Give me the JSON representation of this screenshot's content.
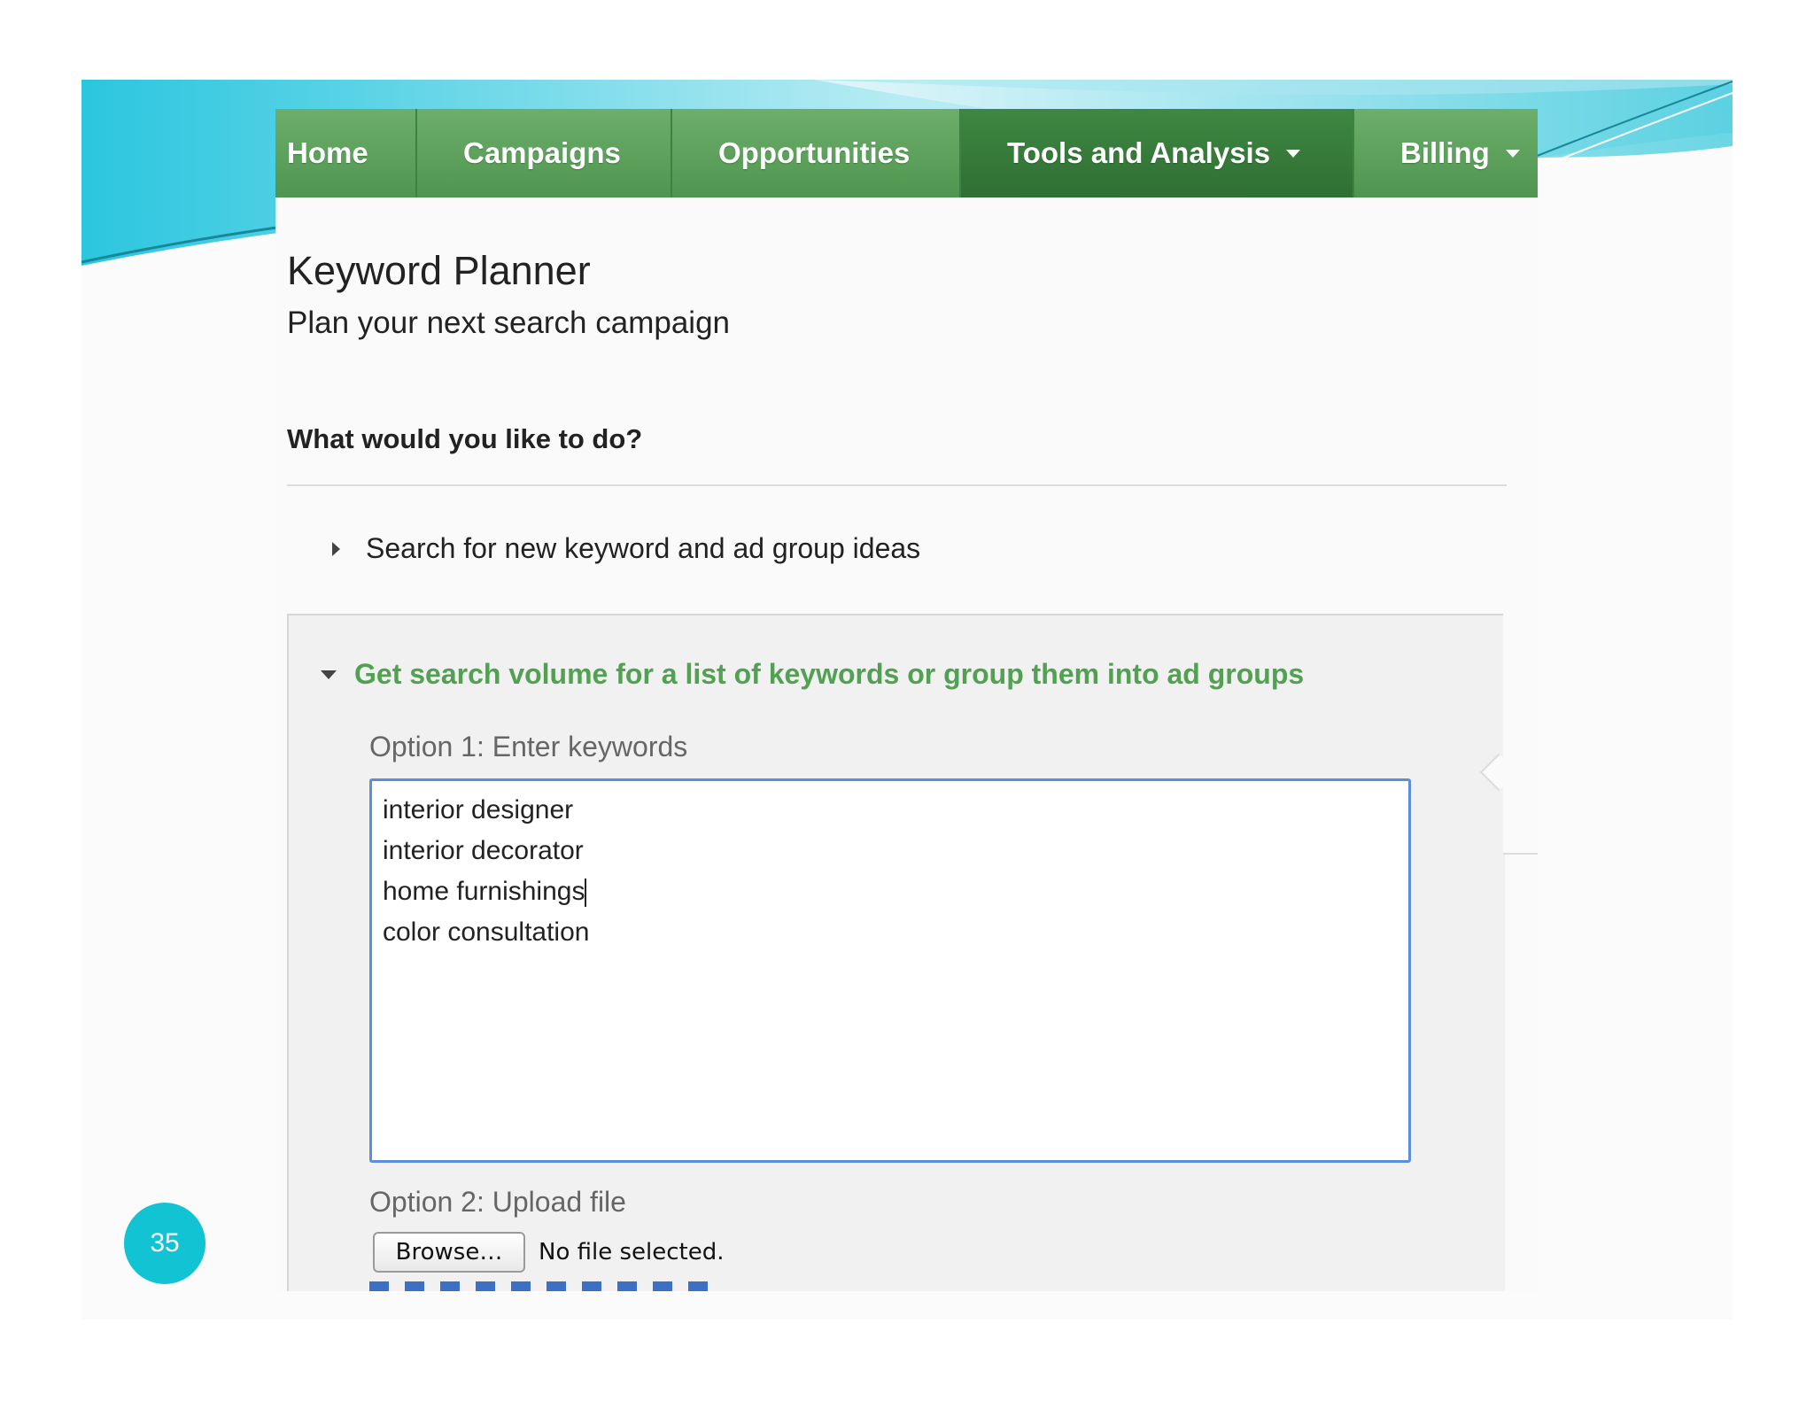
{
  "colors": {
    "nav_green": "#5a9f58",
    "nav_active": "#2f6f33",
    "heading_green": "#52a152",
    "textarea_border": "#5b8fd9",
    "badge": "#12c4d3"
  },
  "slide": {
    "page_number": "35"
  },
  "nav": {
    "items": [
      {
        "label": "Home",
        "icon": null
      },
      {
        "label": "Campaigns",
        "icon": null
      },
      {
        "label": "Opportunities",
        "icon": null
      },
      {
        "label": "Tools and Analysis",
        "icon": "caret-down-icon",
        "active": true
      },
      {
        "label": "Billing",
        "icon": "caret-down-icon"
      }
    ]
  },
  "header": {
    "title": "Keyword Planner",
    "subtitle": "Plan your next search campaign"
  },
  "main": {
    "question": "What would you like to do?",
    "collapsed_option": {
      "label": "Search for new keyword and ad group ideas",
      "icon": "triangle-right-icon"
    },
    "expanded_option": {
      "label": "Get search volume for a list of keywords or group them into ad groups",
      "icon": "triangle-down-icon",
      "option1_label": "Option 1: Enter keywords",
      "keywords": [
        "interior designer",
        "interior decorator",
        "home furnishings",
        "color consultation"
      ],
      "option2_label": "Option 2: Upload file",
      "browse_label": "Browse…",
      "file_status": "No file selected."
    }
  }
}
